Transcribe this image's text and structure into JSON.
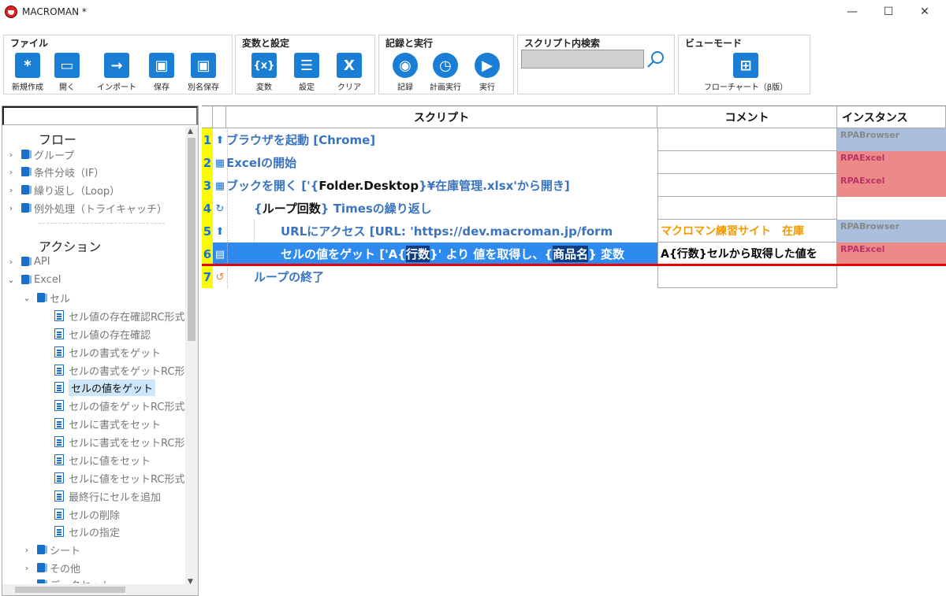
{
  "window": {
    "title": "MACROMAN *",
    "controls": {
      "minimize": "—",
      "maximize": "☐",
      "close": "✕"
    }
  },
  "ribbon": {
    "file": {
      "title": "ファイル",
      "buttons": [
        {
          "label": "新規作成",
          "glyph": "*"
        },
        {
          "label": "開く",
          "glyph": "▭"
        },
        {
          "label": "インポート",
          "glyph": "→"
        },
        {
          "label": "保存",
          "glyph": "▣"
        },
        {
          "label": "別名保存",
          "glyph": "▣"
        }
      ]
    },
    "variables": {
      "title": "変数と設定",
      "buttons": [
        {
          "label": "変数",
          "glyph": "{x}"
        },
        {
          "label": "設定",
          "glyph": "☰"
        },
        {
          "label": "クリア",
          "glyph": "X"
        }
      ]
    },
    "record": {
      "title": "記録と実行",
      "buttons": [
        {
          "label": "記録",
          "glyph": "◉"
        },
        {
          "label": "計画実行",
          "glyph": "◷"
        },
        {
          "label": "実行",
          "glyph": "▶"
        }
      ]
    },
    "search": {
      "title": "スクリプト内検索",
      "placeholder": ""
    },
    "view": {
      "title": "ビューモード",
      "buttons": [
        {
          "label": "フローチャート（β版）",
          "glyph": "⊞"
        }
      ]
    }
  },
  "tree": {
    "flow_heading": "フロー",
    "flow_items": [
      "グループ",
      "条件分岐（IF）",
      "繰り返し（Loop）",
      "例外処理（トライキャッチ）"
    ],
    "action_heading": "アクション",
    "api": "API",
    "excel": "Excel",
    "cell": "セル",
    "cell_items": [
      "セル値の存在確認RC形式",
      "セル値の存在確認",
      "セルの書式をゲット",
      "セルの書式をゲットRC形式",
      "セルの値をゲット",
      "セルの値をゲットRC形式",
      "セルに書式をセット",
      "セルに書式をセットRC形式",
      "セルに値をセット",
      "セルに値をセットRC形式",
      "最終行にセルを追加",
      "セルの削除",
      "セルの指定"
    ],
    "selected_item": "セルの値をゲット",
    "sheet": "シート",
    "other": "その他",
    "dataset": "データセット"
  },
  "grid": {
    "headers": {
      "script": "スクリプト",
      "comment": "コメント",
      "instance": "インスタンス"
    },
    "rows": [
      {
        "num": "1",
        "icon": "browser-icon",
        "text": "ブラウザを起動 [Chrome]",
        "comment": "",
        "instance": "RPABrowser",
        "inst_color": "blue"
      },
      {
        "num": "2",
        "icon": "excel-icon",
        "text": "Excelの開始",
        "comment": "",
        "instance": "RPAExcel",
        "inst_color": "red"
      },
      {
        "num": "3",
        "icon": "excel-icon",
        "text_a": "ブックを開く ['{",
        "text_kw": "Folder.Desktop",
        "text_b": "}¥在庫管理.xlsx'から開き]",
        "comment": "",
        "instance": "RPAExcel",
        "inst_color": "red"
      },
      {
        "num": "4",
        "icon": "loop-icon",
        "text_a": "{",
        "text_kw": "ループ回数",
        "text_b": "} Timesの繰り返し",
        "comment": "",
        "instance": "",
        "inst_color": ""
      },
      {
        "num": "5",
        "icon": "browser-icon",
        "text": "URLにアクセス [URL: 'https://dev.macroman.jp/form",
        "comment": "マクロマン練習サイト　在庫",
        "instance": "RPABrowser",
        "inst_color": "blue"
      },
      {
        "num": "6",
        "icon": "doc-icon",
        "text_a": "セルの値をゲット ['A{",
        "text_kw": "行数",
        "text_b": "}' より 値を取得し、{",
        "text_kw2": "商品名",
        "text_c": "} 変数",
        "comment": "A{行数}セルから取得した値を",
        "instance": "RPAExcel",
        "inst_color": "red"
      },
      {
        "num": "7",
        "icon": "loop-end-icon",
        "text": "ループの終了",
        "comment": "",
        "instance": "",
        "inst_color": ""
      }
    ]
  },
  "colors": {
    "accent": "#1a7fd4",
    "selection": "#2f8af0",
    "linenum_bg": "#fcfc00",
    "marker": "#e00000",
    "inst_blue": "#a9bfdb",
    "inst_red": "#ec8a8a"
  }
}
